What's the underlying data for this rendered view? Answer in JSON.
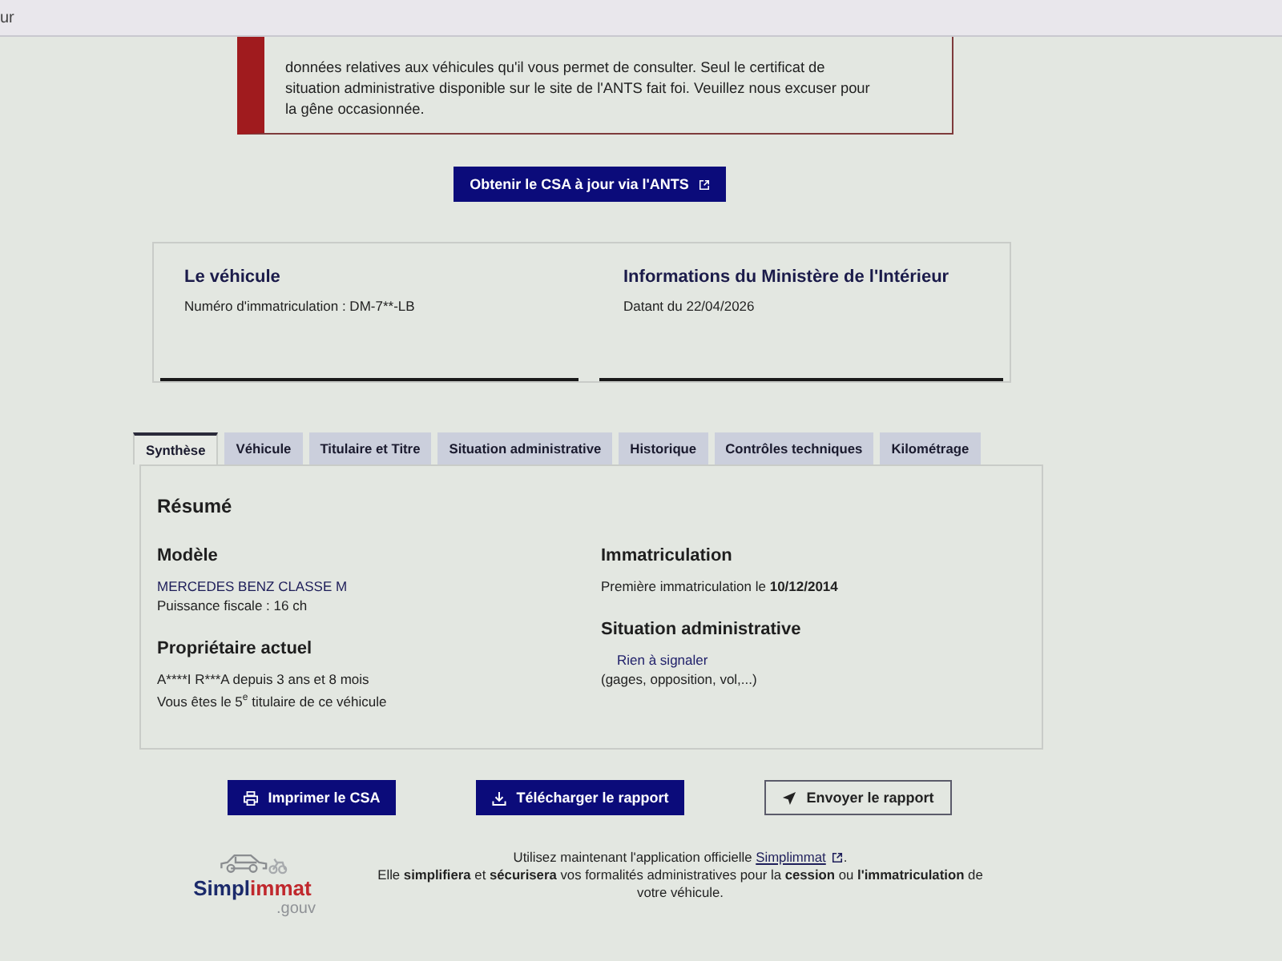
{
  "browser": {
    "tab_text": "ur"
  },
  "notice": {
    "text": "données relatives aux véhicules qu'il vous permet de consulter. Seul le certificat de situation administrative disponible sur le site de l'ANTS fait foi. Veuillez nous excuser pour la gêne occasionnée."
  },
  "csa_button": {
    "label": "Obtenir le CSA à jour via l'ANTS"
  },
  "info_cards": [
    {
      "title": "Le véhicule",
      "text": "Numéro d'immatriculation : DM-7**-LB"
    },
    {
      "title": "Informations du Ministère de l'Intérieur",
      "text": "Datant du 22/04/2026"
    }
  ],
  "tabs": [
    {
      "label": "Synthèse",
      "selected": true
    },
    {
      "label": "Véhicule",
      "selected": false
    },
    {
      "label": "Titulaire et Titre",
      "selected": false
    },
    {
      "label": "Situation administrative",
      "selected": false
    },
    {
      "label": "Historique",
      "selected": false
    },
    {
      "label": "Contrôles techniques",
      "selected": false
    },
    {
      "label": "Kilométrage",
      "selected": false
    }
  ],
  "summary": {
    "title": "Résumé",
    "columns": [
      [
        {
          "heading": "Modèle",
          "lines": [
            {
              "kind": "value",
              "text": "MERCEDES BENZ CLASSE M"
            },
            {
              "kind": "plain",
              "text": "Puissance fiscale : 16 ch"
            }
          ]
        },
        {
          "heading": "Propriétaire actuel",
          "lines": [
            {
              "kind": "plain",
              "text": "A****I R***A depuis 3 ans et 8 mois"
            },
            {
              "kind": "marked",
              "text": "Vous êtes le 5$^{e}$ titulaire de ce véhicule"
            }
          ]
        }
      ],
      [
        {
          "heading": "Immatriculation",
          "lines": [
            {
              "kind": "marked",
              "text": "Première immatriculation le **10/12/2014**"
            }
          ]
        },
        {
          "heading": "Situation administrative",
          "lines": [
            {
              "kind": "status",
              "text": "Rien à signaler"
            },
            {
              "kind": "plain",
              "text": "(gages, opposition, vol,...)"
            }
          ]
        }
      ]
    ]
  },
  "actions": [
    {
      "kind": "print",
      "label": "Imprimer le CSA"
    },
    {
      "kind": "download",
      "label": "Télécharger le rapport"
    },
    {
      "kind": "send",
      "label": "Envoyer le rapport"
    }
  ],
  "footer": {
    "logo": {
      "name_start": "Simpl",
      "name_end": "immat",
      "domain": ".gouv"
    },
    "intro_before": "Utilisez maintenant l'application officielle ",
    "link": "Simplimmat",
    "intro_after": ".",
    "text": "Elle **simplifiera** et **sécurisera** vos formalités administratives pour la **cession** ou **l'immatriculation** de votre véhicule."
  }
}
